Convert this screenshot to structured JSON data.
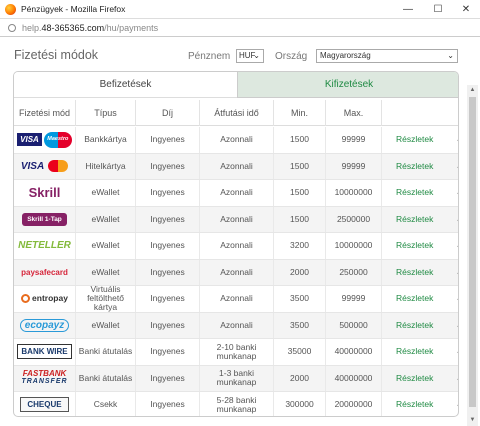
{
  "window": {
    "title": "Pénzügyek - Mozilla Firefox",
    "min": "—",
    "max": "☐",
    "close": "✕"
  },
  "url": {
    "prefix": "help.",
    "host": "48-365365.com",
    "path": "/hu/payments"
  },
  "header": {
    "title": "Fizetési módok",
    "currency_label": "Pénznem",
    "currency_value": "HUF",
    "country_label": "Ország",
    "country_value": "Magyarország"
  },
  "tabs": [
    {
      "label": "Befizetések"
    },
    {
      "label": "Kifizetések"
    }
  ],
  "columns": [
    "Fizetési mód",
    "Típus",
    "Díj",
    "Átfutási idő",
    "Min.",
    "Max.",
    ""
  ],
  "rows": [
    {
      "logo": "visa-maestro-logo",
      "type": "Bankkártya",
      "fee": "Ingyenes",
      "time": "Azonnali",
      "min": "1500",
      "max": "99999",
      "details": "Részletek"
    },
    {
      "logo": "visa-mastercard-logo",
      "type": "Hitelkártya",
      "fee": "Ingyenes",
      "time": "Azonnali",
      "min": "1500",
      "max": "99999",
      "details": "Részletek"
    },
    {
      "logo": "skrill-logo",
      "type": "eWallet",
      "fee": "Ingyenes",
      "time": "Azonnali",
      "min": "1500",
      "max": "10000000",
      "details": "Részletek"
    },
    {
      "logo": "skrill-1tap-logo",
      "type": "eWallet",
      "fee": "Ingyenes",
      "time": "Azonnali",
      "min": "1500",
      "max": "2500000",
      "details": "Részletek"
    },
    {
      "logo": "neteller-logo",
      "type": "eWallet",
      "fee": "Ingyenes",
      "time": "Azonnali",
      "min": "3200",
      "max": "10000000",
      "details": "Részletek"
    },
    {
      "logo": "paysafecard-logo",
      "type": "eWallet",
      "fee": "Ingyenes",
      "time": "Azonnali",
      "min": "2000",
      "max": "250000",
      "details": "Részletek"
    },
    {
      "logo": "entropay-logo",
      "type": "Virtuális feltölthető kártya",
      "fee": "Ingyenes",
      "time": "Azonnali",
      "min": "3500",
      "max": "99999",
      "details": "Részletek"
    },
    {
      "logo": "ecopayz-logo",
      "type": "eWallet",
      "fee": "Ingyenes",
      "time": "Azonnali",
      "min": "3500",
      "max": "500000",
      "details": "Részletek"
    },
    {
      "logo": "bank-wire-logo",
      "type": "Banki átutalás",
      "fee": "Ingyenes",
      "time": "2-10 banki munkanap",
      "min": "35000",
      "max": "40000000",
      "details": "Részletek"
    },
    {
      "logo": "fastbank-transfer-logo",
      "type": "Banki átutalás",
      "fee": "Ingyenes",
      "time": "1-3 banki munkanap",
      "min": "2000",
      "max": "40000000",
      "details": "Részletek"
    },
    {
      "logo": "cheque-logo",
      "type": "Csekk",
      "fee": "Ingyenes",
      "time": "5-28 banki munkanap",
      "min": "300000",
      "max": "20000000",
      "details": "Részletek"
    }
  ],
  "logos": {
    "visa": "VISA",
    "maestro": "Maestro",
    "skrill": "Skrill",
    "skrill1tap": "Skrill 1-Tap",
    "neteller": "NETELLER",
    "paysafe": "paysafecard",
    "entropay": "entropay",
    "ecopayz": "ecopayz",
    "bankwire": "BANK WIRE",
    "fastbank1": "FASTBANK",
    "fastbank2": "TRANSFER",
    "cheque": "CHEQUE"
  },
  "colors": {
    "accent": "#1f8a43",
    "tab_active_bg": "#dde8df"
  }
}
